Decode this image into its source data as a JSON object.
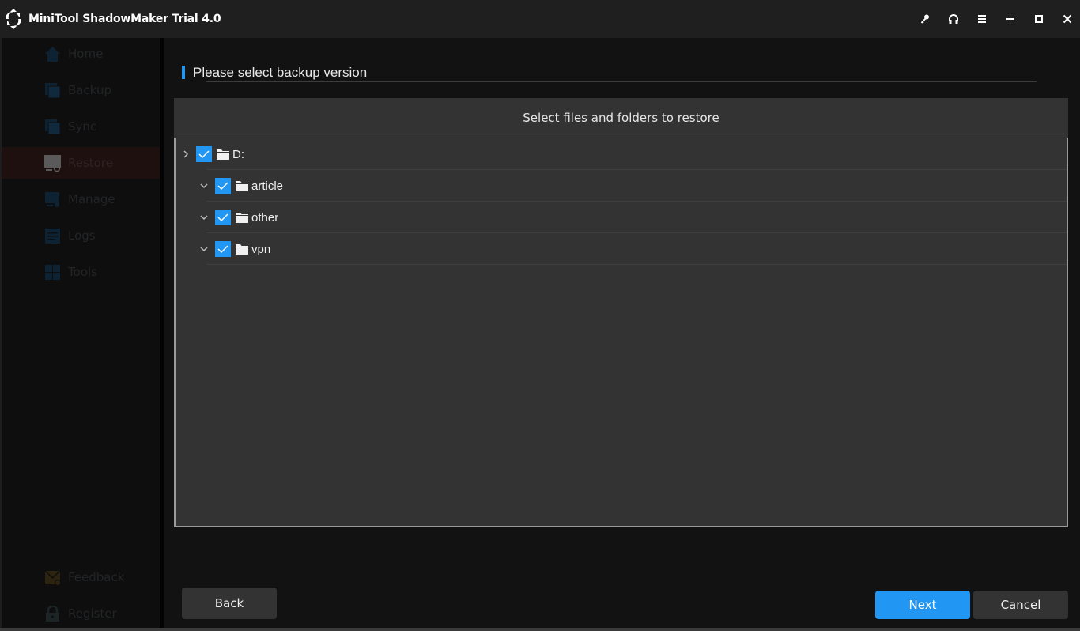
{
  "app": {
    "title": "MiniTool ShadowMaker Trial 4.0"
  },
  "titlebar": {
    "buttons": [
      {
        "name": "key-icon",
        "label": "Register key"
      },
      {
        "name": "headset-icon",
        "label": "Support"
      },
      {
        "name": "menu-icon",
        "label": "Menu"
      },
      {
        "name": "minimize-icon",
        "label": "Minimize"
      },
      {
        "name": "maximize-icon",
        "label": "Maximize"
      },
      {
        "name": "close-icon",
        "label": "Close"
      }
    ]
  },
  "sidebar": {
    "items": [
      {
        "label": "Home",
        "icon": "home-icon",
        "active": false
      },
      {
        "label": "Backup",
        "icon": "backup-icon",
        "active": false
      },
      {
        "label": "Sync",
        "icon": "sync-icon",
        "active": false
      },
      {
        "label": "Restore",
        "icon": "restore-icon",
        "active": true
      },
      {
        "label": "Manage",
        "icon": "manage-icon",
        "active": false
      },
      {
        "label": "Logs",
        "icon": "logs-icon",
        "active": false
      },
      {
        "label": "Tools",
        "icon": "tools-icon",
        "active": false
      }
    ],
    "footer": [
      {
        "label": "Feedback",
        "icon": "feedback-icon"
      },
      {
        "label": "Register",
        "icon": "lock-icon"
      }
    ]
  },
  "dialog": {
    "title": "Please select backup version",
    "panel_header": "Select files and folders to restore",
    "tree": [
      {
        "label": "D:",
        "checked": true,
        "expanded": false,
        "level": 0
      },
      {
        "label": "article",
        "checked": true,
        "expanded": true,
        "level": 1
      },
      {
        "label": "other",
        "checked": true,
        "expanded": true,
        "level": 1
      },
      {
        "label": "vpn",
        "checked": true,
        "expanded": true,
        "level": 1
      }
    ],
    "buttons": {
      "back": "Back",
      "next": "Next",
      "cancel": "Cancel"
    }
  },
  "colors": {
    "accent": "#2196f3",
    "background": "#121212",
    "panel": "#333333",
    "titlebar": "#1f1f1f"
  }
}
